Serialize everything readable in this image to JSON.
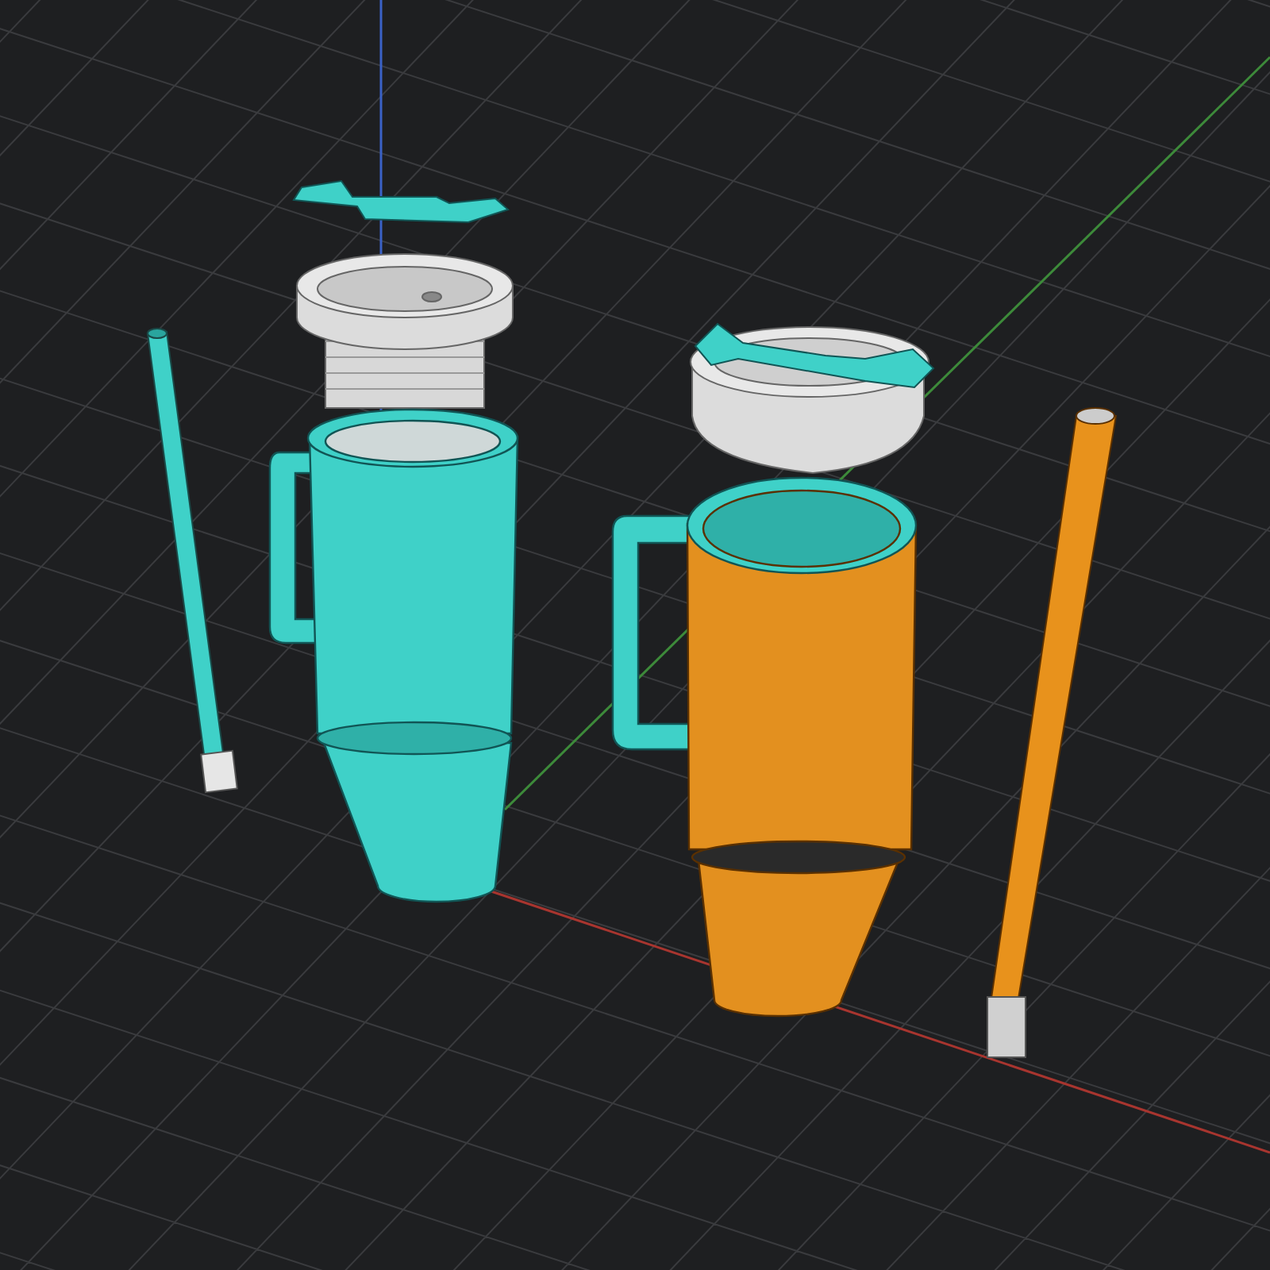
{
  "tumblers": [
    {
      "color": "#3fd1c8"
    },
    {
      "color": "#e3901f"
    }
  ],
  "clips": [
    {
      "color": "#3fd1c8"
    },
    {
      "color": "#3fd1c8"
    }
  ],
  "straws": [
    {
      "color": "#3fd1c8"
    },
    {
      "color": "#e8921c"
    }
  ]
}
